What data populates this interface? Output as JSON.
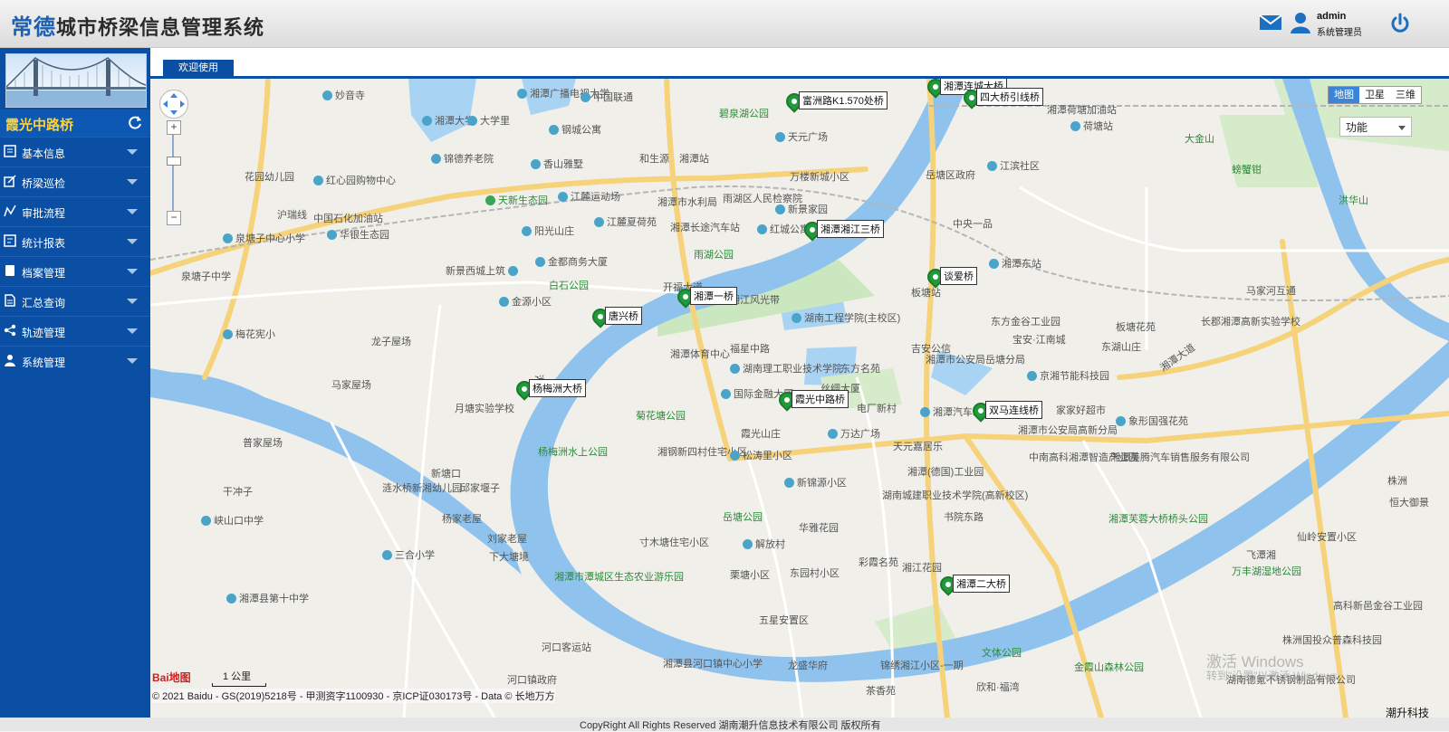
{
  "header": {
    "brand": "常德",
    "system_title": "城市桥梁信息管理系统",
    "user_name": "admin",
    "user_role": "系统管理员"
  },
  "sidebar": {
    "current_bridge": "霞光中路桥",
    "menu": [
      {
        "label": "基本信息",
        "icon": "info-icon"
      },
      {
        "label": "桥梁巡检",
        "icon": "edit-icon"
      },
      {
        "label": "审批流程",
        "icon": "trend-icon"
      },
      {
        "label": "统计报表",
        "icon": "report-icon"
      },
      {
        "label": "档案管理",
        "icon": "file-icon"
      },
      {
        "label": "汇总查询",
        "icon": "document-icon"
      },
      {
        "label": "轨迹管理",
        "icon": "share-icon"
      },
      {
        "label": "系统管理",
        "icon": "user-icon"
      }
    ]
  },
  "tabs": [
    {
      "label": "欢迎使用"
    }
  ],
  "map": {
    "map_types": [
      "地图",
      "卫星",
      "三维"
    ],
    "active_map_type": "地图",
    "function_select": "功能",
    "scale": "1 公里",
    "attribution": "© 2021 Baidu - GS(2019)5218号 - 甲测资字1100930 - 京ICP证030173号 - Data © 长地万方",
    "baidu_logo": "Bai地图",
    "bridges": [
      "湘潭二大桥",
      "四大桥引线桥",
      "富洲路K1.570处桥",
      "湘潭湘江三桥",
      "谈爱桥",
      "湘潭一桥",
      "唐兴桥",
      "杨梅洲大桥",
      "霞光中路桥",
      "双马连线桥",
      "湘潭二大桥"
    ],
    "bridge_texts": {
      "b0": "湘潭连城大桥",
      "b1": "四大桥引线桥",
      "b2": "富洲路K1.570处桥",
      "b3": "湘潭湘江三桥",
      "b4": "谈爱桥",
      "b5": "湘潭一桥",
      "b6": "唐兴桥",
      "b7": "杨梅洲大桥",
      "b8": "霞光中路桥",
      "b9": "双马连线桥",
      "b10": "湘潭二大桥"
    },
    "pois": {
      "p1": "湘潭大学",
      "p2": "大学里",
      "p3": "湘潭广播电视大学",
      "p4": "中国联通",
      "p5": "钢城公寓",
      "p6": "香山雅墅",
      "p7": "锦德养老院",
      "p8": "红心园购物中心",
      "p9": "花园幼儿园",
      "p10": "中国石化加油站",
      "p11": "华银生态园",
      "p12": "泉塘子中心小学",
      "p13": "泉塘子中学",
      "p14": "天新生态园",
      "p15": "江麓运动场",
      "p16": "阳光山庄",
      "p17": "江麓夏荷苑",
      "p18": "金都商务大厦",
      "p19": "新景西城上筑",
      "p20": "白石公园",
      "p21": "金源小区",
      "p22": "和生源",
      "p23": "湘潭站",
      "p24": "湘潭市水利局",
      "p25": "雨湖区人民检察院",
      "p26": "湘潭长途汽车站",
      "p27": "雨湖公园",
      "p28": "天元广场",
      "p29": "万楼新城小区",
      "p30": "新景家园",
      "p31": "红城公寓",
      "p32": "湘潭体育中心",
      "p33": "湖南工程学院(主校区)",
      "p34": "湖南理工职业技术学院",
      "p35": "国际金融大厦",
      "p36": "霞光山庄",
      "p37": "菊花塘公园",
      "p38": "湘钢新四村住宅小区",
      "p39": "松涛里小区",
      "p40": "新锦源小区",
      "p41": "岳塘公园",
      "p42": "华雅花园",
      "p43": "寸木塘住宅小区",
      "p44": "解放村",
      "p45": "栗塘小区",
      "p46": "东园村小区",
      "p47": "五星安置区",
      "p48": "湘潭县河口镇中心小学",
      "p49": "河口客运站",
      "p50": "河口镇政府",
      "p51": "龙盛华府",
      "p52": "锦绣湘江小区-一期",
      "p53": "茶香苑",
      "p54": "欣和·福湾",
      "p55": "金霞山森林公园",
      "p56": "文体公园",
      "p57": "湘潭市潭城区生态农业游乐园",
      "p58": "杨梅洲水上公园",
      "p59": "月塘实验学校",
      "p60": "涟水桥新湘幼儿园",
      "p61": "峡山口中学",
      "p62": "三合小学",
      "p63": "湘潭县第十中学",
      "p64": "梅花宪小",
      "p65": "岳塘区政府",
      "p66": "江滨社区",
      "p67": "中央一品",
      "p68": "湘潭东站",
      "p69": "板塘站",
      "p70": "东方金谷工业园",
      "p71": "宝安·江南城",
      "p72": "东湖山庄",
      "p73": "板塘花苑",
      "p74": "长郡湘潭高新实验学校",
      "p75": "京湘节能科技园",
      "p76": "湘潭市公安局岳塘分局",
      "p77": "吉安公信",
      "p78": "东方名苑",
      "p79": "丝绸大厦",
      "p80": "电厂新村",
      "p81": "湘潭汽车站",
      "p82": "家家好超市",
      "p83": "湘潭市公安局高新分局",
      "p84": "象形国强花苑",
      "p85": "万达广场",
      "p86": "天元嘉居乐",
      "p87": "湘潭(德国)工业园",
      "p88": "湖南城建职业技术学院(高新校区)",
      "p89": "湘江花园",
      "p90": "彩霞名苑",
      "p91": "中南高科湘潭智造产业园",
      "p92": "湘潭美腾汽车销售服务有限公司",
      "p93": "湘潭芙蓉大桥桥头公园",
      "p94": "万丰湖湿地公园",
      "p95": "仙岭安置小区",
      "p96": "高科新邑金谷工业园",
      "p97": "株洲国投众普森科技园",
      "p98": "湖南德氪不锈钢制品有限公司",
      "p99": "马家河互通",
      "p100": "大金山",
      "p101": "螃蟹钳",
      "p102": "洪华山",
      "p103": "荷塘站",
      "p104": "湘潭荷塘加油站",
      "p105": "碧泉湖公园",
      "p106": "湘潭连城大桥",
      "p107": "妙音寺",
      "p108": "白鹤公园",
      "p109": "沪瑞线",
      "p110": "湘潭大道",
      "p111": "霞光中路",
      "p112": "福星中路",
      "p113": "书院东路",
      "p114": "湘江",
      "p115": "湘江风光带",
      "p116": "开福大道",
      "p117": "株洲",
      "p118": "恒大御景",
      "p119": "株洲德",
      "p120": "河口镇",
      "p121": "飞潭湘",
      "p122": "马家屋场",
      "p123": "龙子屋场",
      "p124": "普家屋场",
      "p125": "干冲子",
      "p126": "杨家老屋",
      "p127": "刘家老屋",
      "p128": "下大塘境",
      "p129": "新塘口",
      "p130": "邱家堰子"
    }
  },
  "footer": {
    "copyright": "CopyRight All Rights Reserved 湖南潮升信息技术有限公司 版权所有",
    "company_tag": "潮升科技"
  },
  "watermark": {
    "line1": "激活 Windows",
    "line2": "转到\"设置\"以激活 Windows。"
  },
  "colors": {
    "brand_blue": "#0a4fa3",
    "bridge_title": "#ffd23a",
    "river": "#8fc3ed",
    "marker": "#1f9b3a"
  }
}
